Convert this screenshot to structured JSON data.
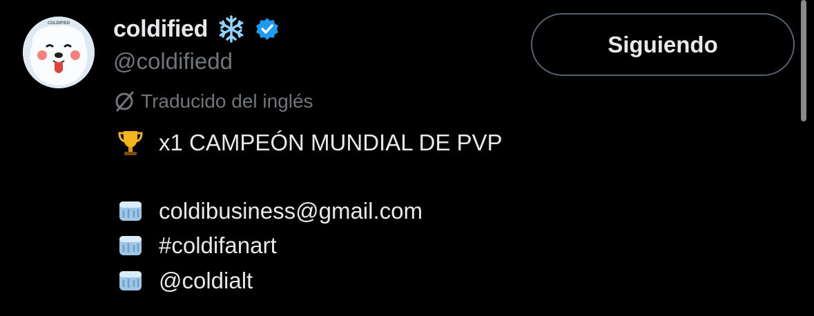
{
  "profile": {
    "display_name": "coldified",
    "handle": "@coldifiedd",
    "avatar_text": "COLDIFIED",
    "icons": {
      "name_emoji": "snowflake-icon",
      "verified": "verified-badge-icon"
    },
    "colors": {
      "verified": "#1d9bf0",
      "muted": "#71767b",
      "text": "#e7e9ea",
      "background": "#000000"
    }
  },
  "follow_button": {
    "label": "Siguiendo"
  },
  "translation": {
    "label": "Traducido del inglés",
    "icon": "translate-slash-icon"
  },
  "bio": {
    "headline": {
      "icon": "trophy-icon",
      "text": "x1 CAMPEÓN MUNDIAL DE PVP"
    },
    "lines": [
      {
        "icon": "ice-cube-icon",
        "text": "coldibusiness@gmail.com"
      },
      {
        "icon": "ice-cube-icon",
        "text": "#coldifanart"
      },
      {
        "icon": "ice-cube-icon",
        "text": "@coldialt"
      }
    ]
  }
}
